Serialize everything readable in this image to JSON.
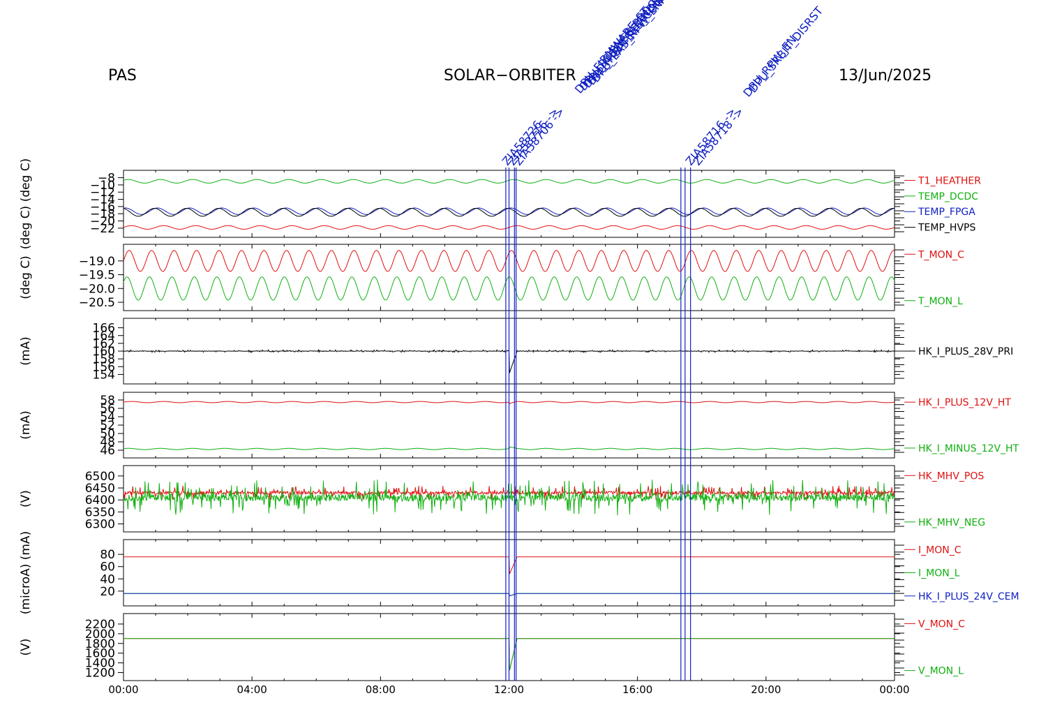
{
  "header": {
    "left": "PAS",
    "center": "SOLAR−ORBITER",
    "right": "13/Jun/2025"
  },
  "colors": {
    "red": "#e01010",
    "green": "#10b010",
    "blue": "#1020c0",
    "black": "#000000",
    "event": "#1020c0"
  },
  "chart_data": {
    "type": "line",
    "x_axis": {
      "ticks": [
        "00:00",
        "04:00",
        "08:00",
        "12:00",
        "16:00",
        "20:00",
        "00:00"
      ],
      "range_hours": [
        0,
        24
      ]
    },
    "event_lines_hours": [
      11.9,
      12.0,
      12.17,
      12.22,
      17.35,
      17.48,
      17.65
    ],
    "event_labels": [
      {
        "text": "ZIA58726",
        "hour": 11.95,
        "group": 1
      },
      {
        "text": "ZIA58716 ->",
        "hour": 12.05,
        "group": 1
      },
      {
        "text": "ZIA58706 ->",
        "hour": 12.15,
        "group": 1
      },
      {
        "text": "ZIA58716 ->",
        "hour": 17.4,
        "group": 2
      },
      {
        "text": "ZIA58718 ->",
        "hour": 17.55,
        "group": 2
      }
    ],
    "event_texts_group1": [
      "DPU_FIRMWARE_ST",
      "DPU_SCIENCE_PROC",
      "DPU_MODE_STANDBY",
      "DPU_HEATERS_CONTROL",
      "DPU_EAS_RPW_ENABLE"
    ],
    "event_texts_group2": [
      "DPU_RPW_EN",
      "DPU_SRBIT_DISRST"
    ],
    "panels": [
      {
        "ylabel": "(deg C)  (deg C)",
        "ticks": [
          "−8",
          "−10",
          "−12",
          "−14",
          "−16",
          "−18",
          "−20",
          "−22"
        ],
        "ylim": [
          -23,
          -7.5
        ],
        "series": [
          {
            "name": "T1_HEATHER",
            "color": "#e01010",
            "base": -21.8,
            "amp": 0.5,
            "period_h": 1.0,
            "glitch": 0
          },
          {
            "name": "TEMP_DCDC",
            "color": "#10b010",
            "base": -9.0,
            "amp": 0.5,
            "period_h": 1.0,
            "glitch": 0
          },
          {
            "name": "TEMP_FPGA",
            "color": "#1020c0",
            "base": -17.3,
            "amp": 0.9,
            "period_h": 1.0,
            "glitch": 0
          },
          {
            "name": "TEMP_HVPS",
            "color": "#000000",
            "base": -17.6,
            "amp": 1.1,
            "period_h": 1.0,
            "glitch": 0
          }
        ]
      },
      {
        "ylabel": "(deg C)",
        "ticks": [
          "−19.0",
          "−19.5",
          "−20.0",
          "−20.5"
        ],
        "ylim": [
          -20.6,
          -18.6
        ],
        "series": [
          {
            "name": "T_MON_C",
            "color": "#e01010",
            "base": -19.0,
            "amp": 0.38,
            "period_h": 0.7,
            "glitch": 0
          },
          {
            "name": "T_MON_L",
            "color": "#10b010",
            "base": -20.0,
            "amp": 0.42,
            "period_h": 0.7,
            "glitch": 0
          }
        ]
      },
      {
        "ylabel": "(mA)",
        "ticks": [
          "166",
          "164",
          "162",
          "160",
          "158",
          "156",
          "154"
        ],
        "ylim": [
          153,
          167
        ],
        "series": [
          {
            "name": "HK_I_PLUS_28V_PRI",
            "color": "#000000",
            "base": 160.0,
            "amp": 0.12,
            "period_h": 0.05,
            "glitch": -6
          }
        ]
      },
      {
        "ylabel": "(mA)",
        "ticks": [
          "58",
          "56",
          "54",
          "52",
          "50",
          "48",
          "46"
        ],
        "ylim": [
          45.5,
          58.5
        ],
        "series": [
          {
            "name": "HK_I_PLUS_12V_HT",
            "color": "#e01010",
            "base": 57.5,
            "amp": 0.15,
            "period_h": 1.0,
            "glitch": -0.4
          },
          {
            "name": "HK_I_MINUS_12V_HT",
            "color": "#10b010",
            "base": 46.3,
            "amp": 0.15,
            "period_h": 1.0,
            "glitch": 0.4
          }
        ]
      },
      {
        "ylabel": "(V)",
        "ticks": [
          "6500",
          "6450",
          "6400",
          "6350",
          "6300"
        ],
        "ylim": [
          6290,
          6520
        ],
        "series": [
          {
            "name": "HK_MHV_POS",
            "color": "#e01010",
            "base": 6430,
            "amp": 12,
            "period_h": 0.02,
            "glitch": 0
          },
          {
            "name": "HK_MHV_NEG",
            "color": "#10b010",
            "base": 6410,
            "amp": 30,
            "period_h": 0.02,
            "glitch": 0
          }
        ]
      },
      {
        "ylabel": "(microA)  (mA)",
        "ticks": [
          "80",
          "60",
          "40",
          "20"
        ],
        "ylim": [
          5,
          95
        ],
        "series": [
          {
            "name": "I_MON_C",
            "color": "#e01010",
            "base": 76,
            "amp": 0,
            "period_h": 1.0,
            "glitch": -30
          },
          {
            "name": "I_MON_L",
            "color": "#10b010",
            "base": 16,
            "amp": 0,
            "period_h": 1.0,
            "glitch": -4
          },
          {
            "name": "HK_I_PLUS_24V_CEM",
            "color": "#1020c0",
            "base": 16,
            "amp": 0,
            "period_h": 1.0,
            "glitch": -4
          }
        ]
      },
      {
        "ylabel": "(V)",
        "ticks": [
          "2200",
          "2000",
          "1800",
          "1600",
          "1400",
          "1200"
        ],
        "ylim": [
          1150,
          2300
        ],
        "series": [
          {
            "name": "V_MON_C",
            "color": "#e01010",
            "base": 1900,
            "amp": 0,
            "period_h": 1.0,
            "glitch": -700
          },
          {
            "name": "V_MON_L",
            "color": "#10b010",
            "base": 1900,
            "amp": 0,
            "period_h": 1.0,
            "glitch": -700
          }
        ]
      }
    ]
  }
}
